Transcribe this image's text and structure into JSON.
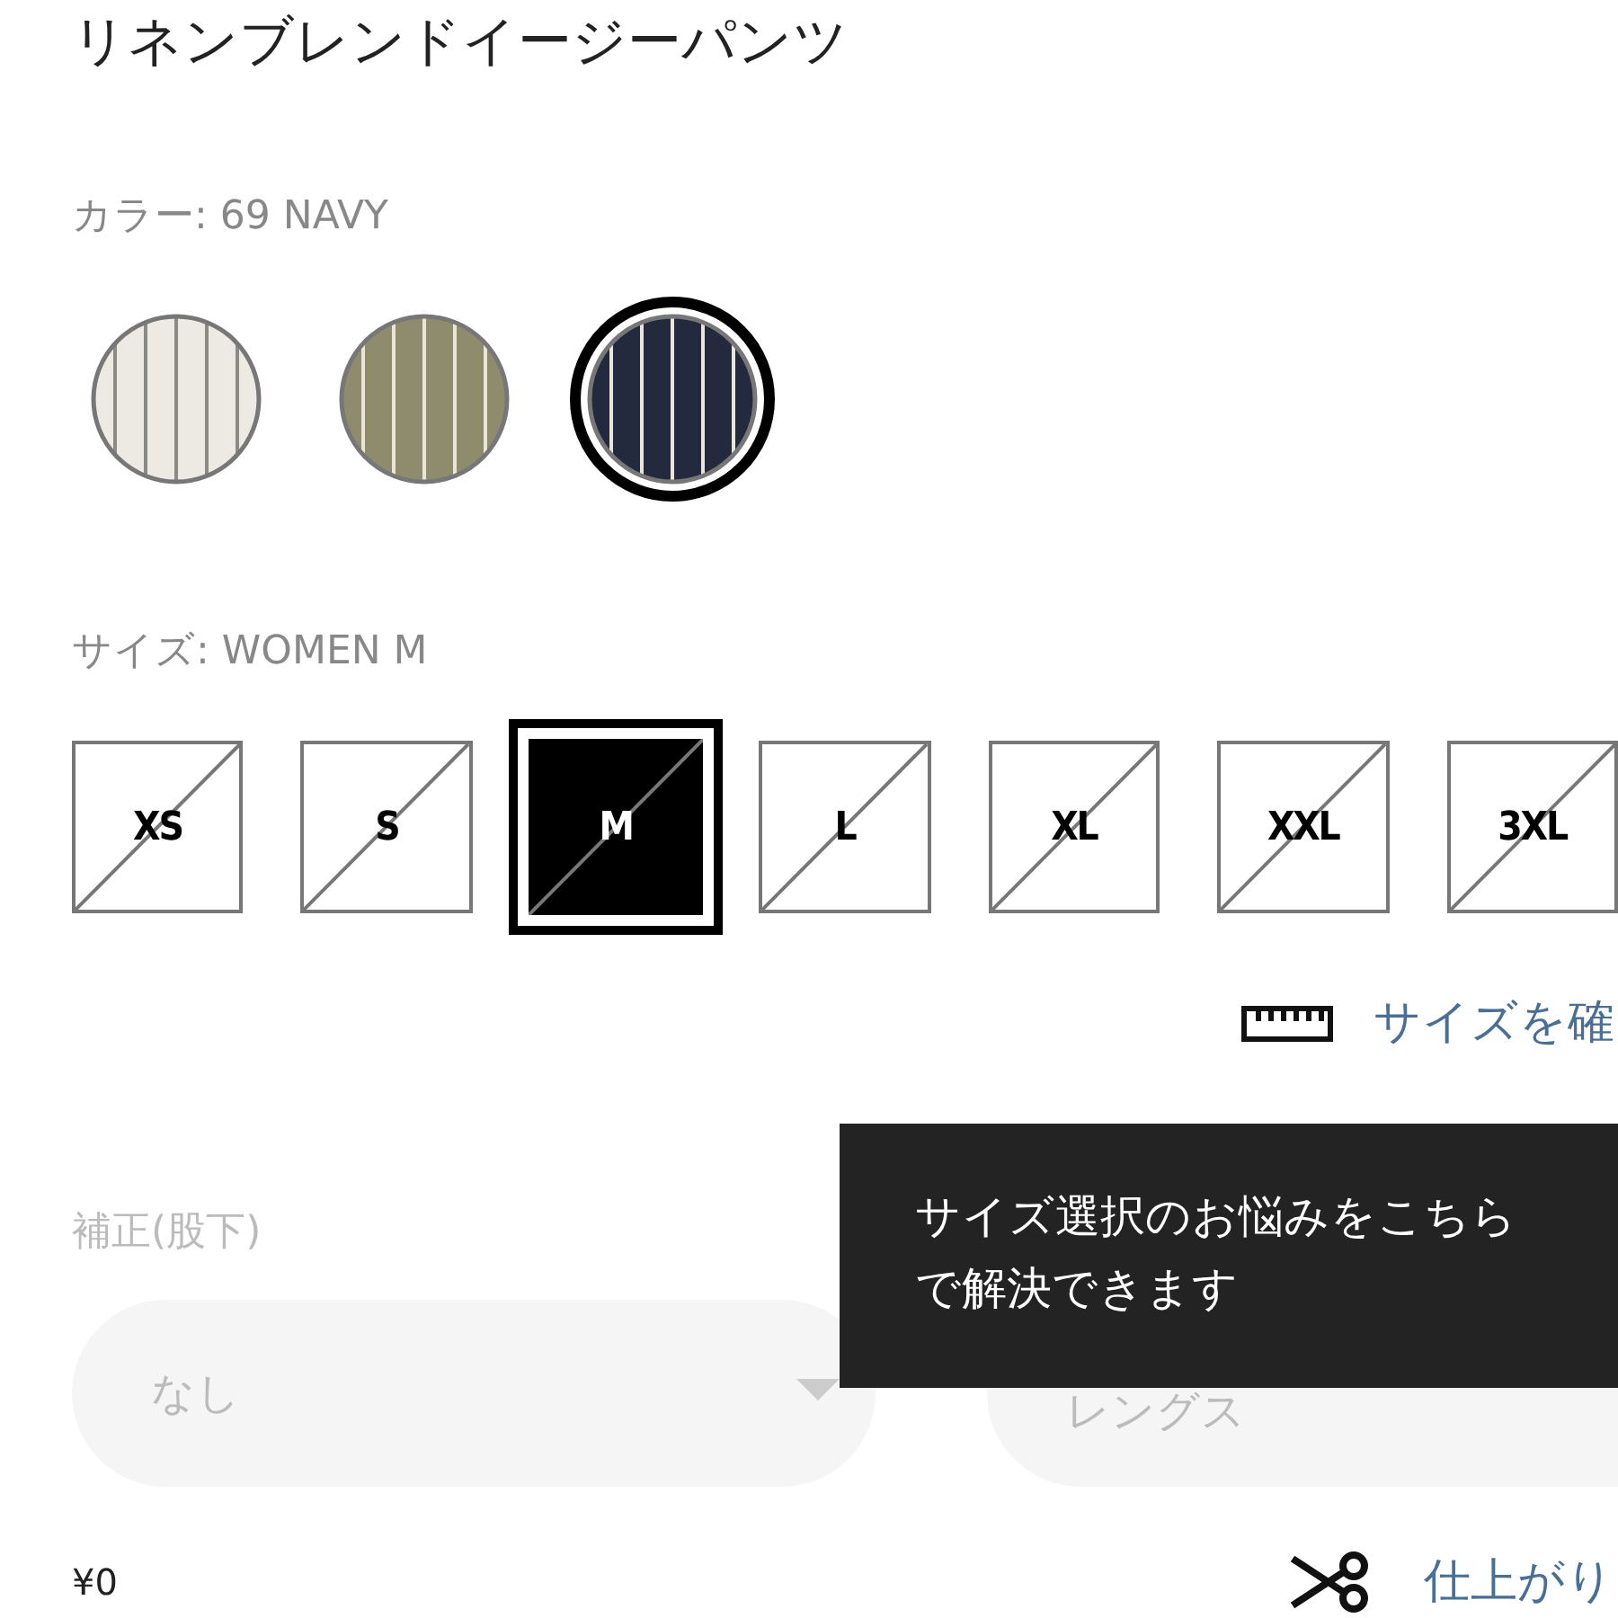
{
  "title": "リネンブレンドイージーパンツ",
  "color_label": "カラー: 69 NAVY",
  "swatches": [
    {
      "color": "#eceae3",
      "selected": false
    },
    {
      "color": "#8f8c6e",
      "selected": false
    },
    {
      "color": "#232a3d",
      "selected": true
    }
  ],
  "size_label": "サイズ: WOMEN M",
  "sizes": [
    {
      "label": "XS",
      "unavailable": true,
      "selected": false
    },
    {
      "label": "S",
      "unavailable": true,
      "selected": false
    },
    {
      "label": "M",
      "unavailable": true,
      "selected": true
    },
    {
      "label": "L",
      "unavailable": true,
      "selected": false
    },
    {
      "label": "XL",
      "unavailable": true,
      "selected": false
    },
    {
      "label": "XXL",
      "unavailable": true,
      "selected": false
    },
    {
      "label": "3XL",
      "unavailable": true,
      "selected": false
    }
  ],
  "size_guide_link": "サイズを確",
  "tooltip": "サイズ選択のお悩みをこちらで解決できます",
  "adjust_label": "補正(股下)",
  "dropdowns": [
    {
      "value": "なし"
    },
    {
      "value": "レングス"
    }
  ],
  "price": "¥0",
  "finish_link": "仕上がり"
}
